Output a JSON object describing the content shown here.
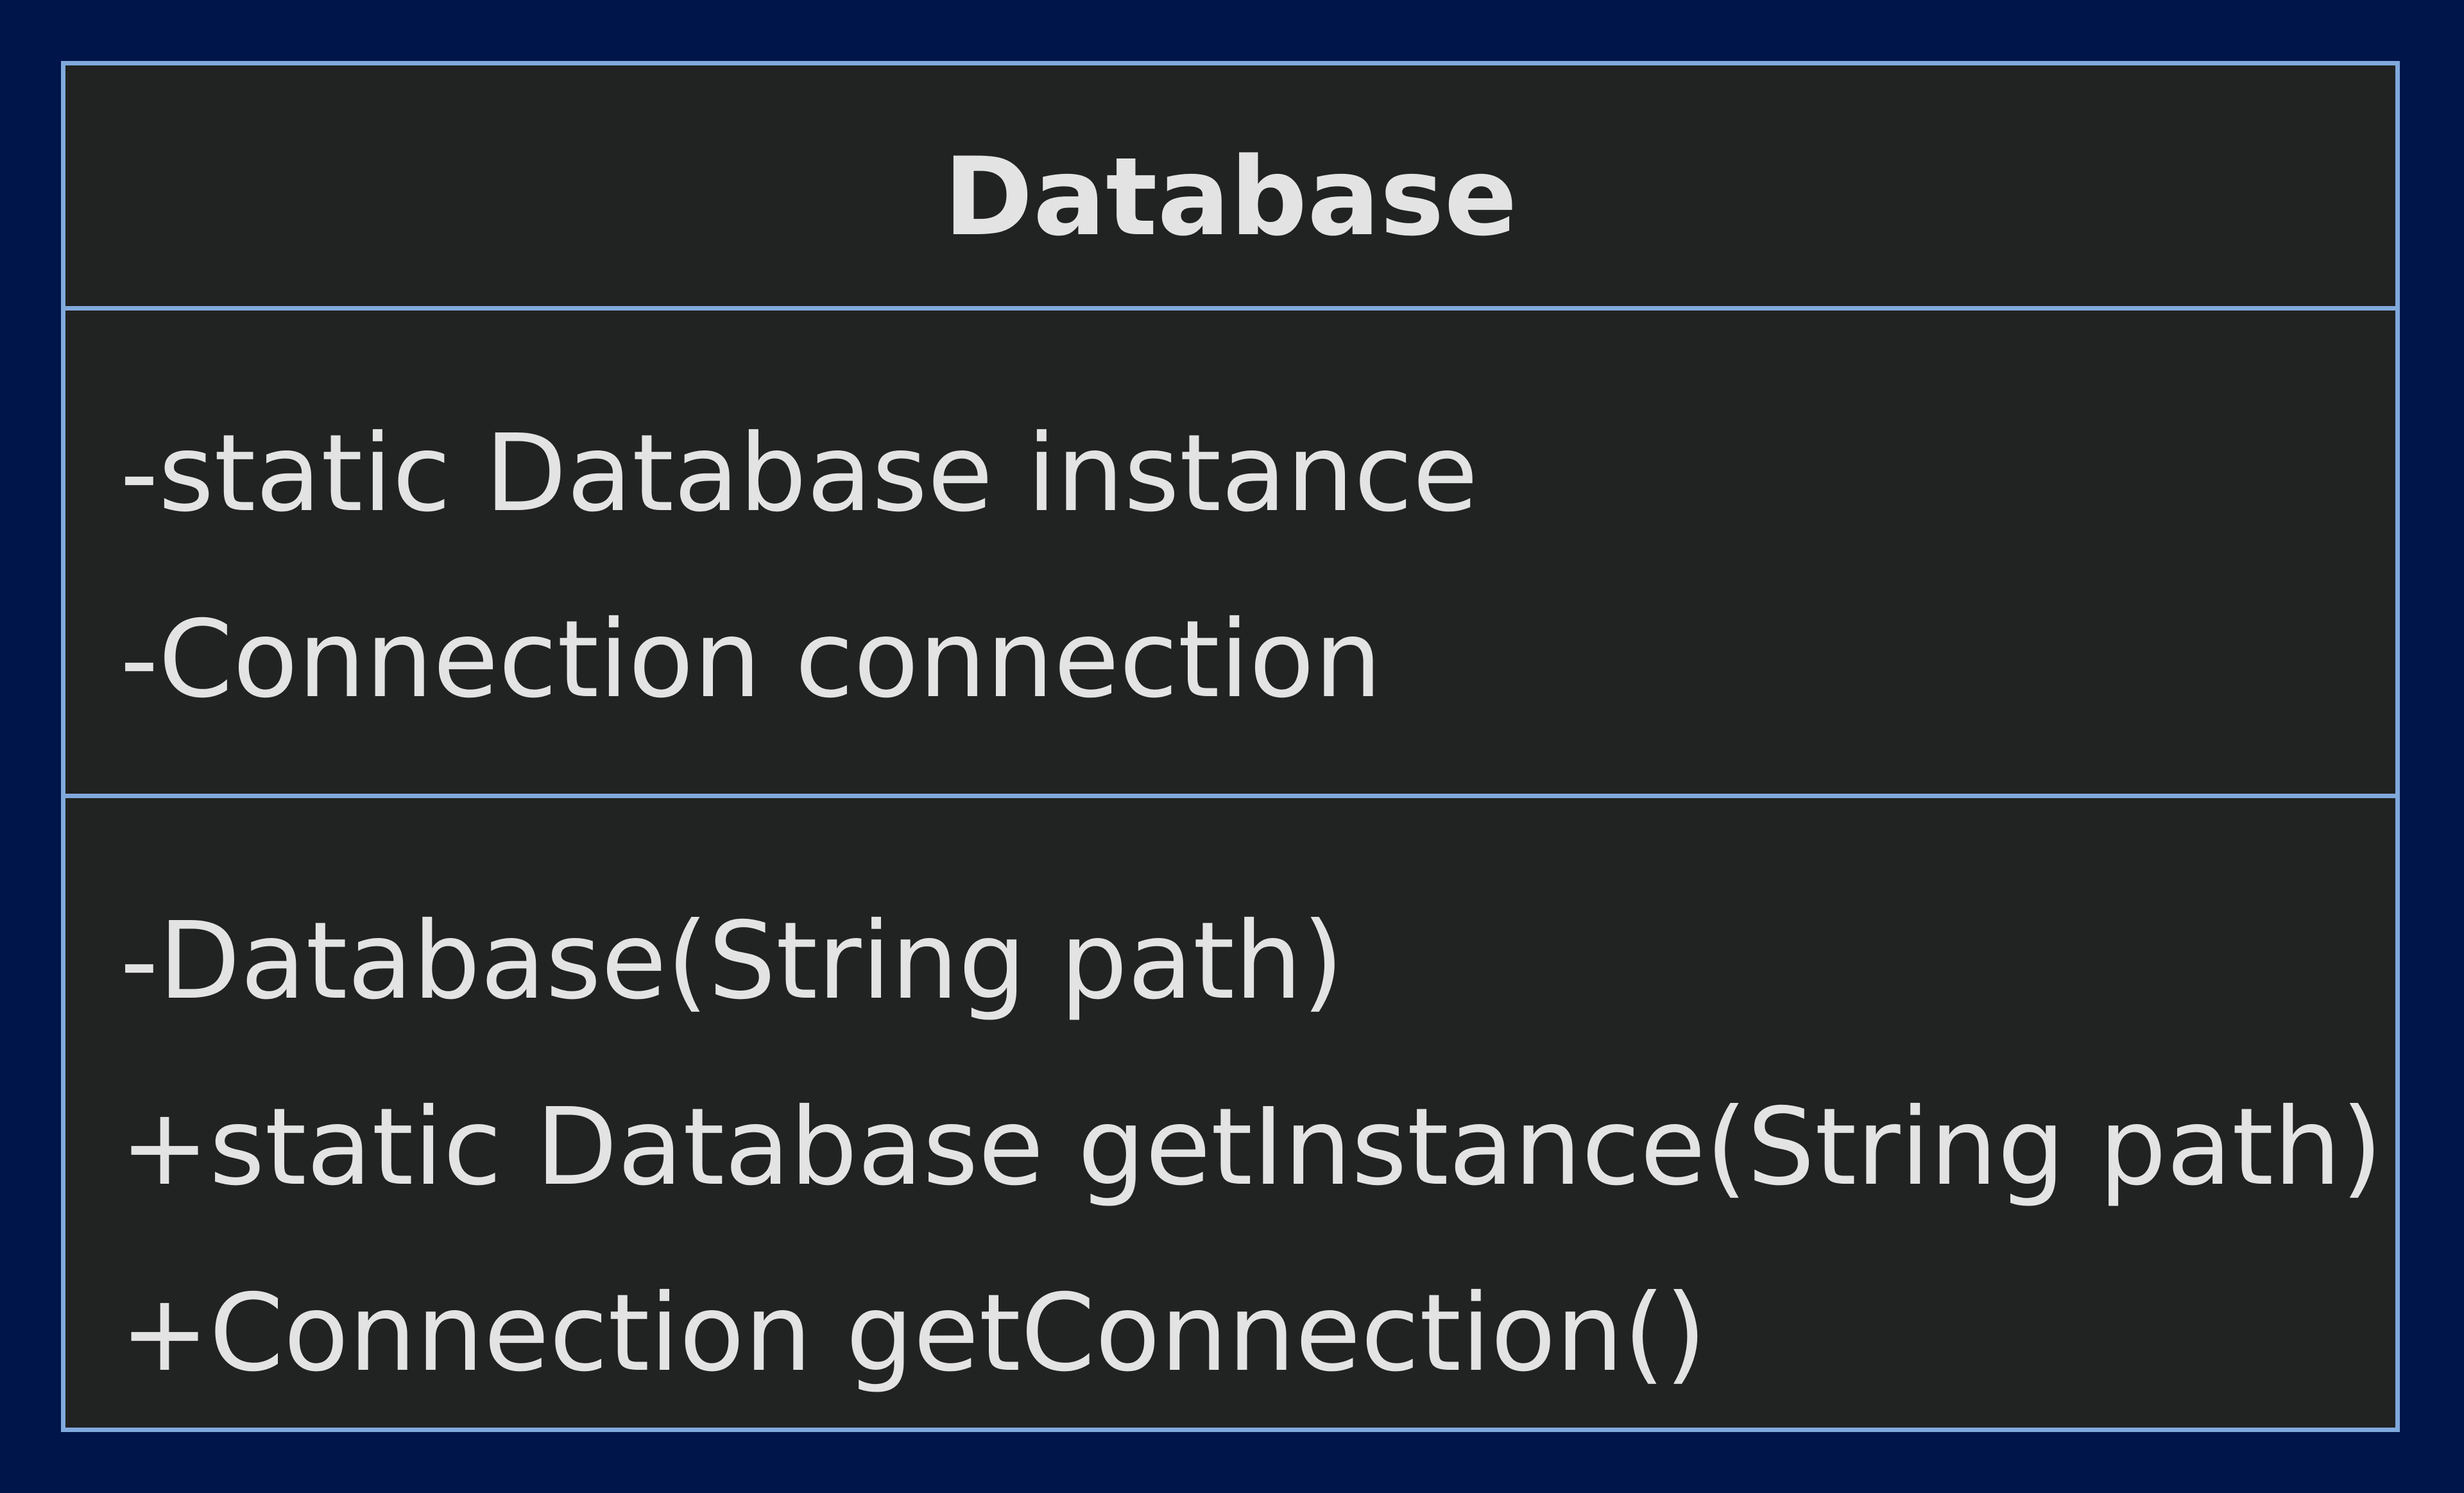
{
  "uml_class": {
    "name": "Database",
    "attributes": [
      "-static Database instance",
      "-Connection connection"
    ],
    "methods": [
      "-Database(String path)",
      "+static Database getInstance(String path)",
      "+Connection getConnection()"
    ]
  },
  "colors": {
    "background": "#00154a",
    "box_fill": "#212222",
    "border": "#80a9dc",
    "text": "#e3e3e3"
  }
}
